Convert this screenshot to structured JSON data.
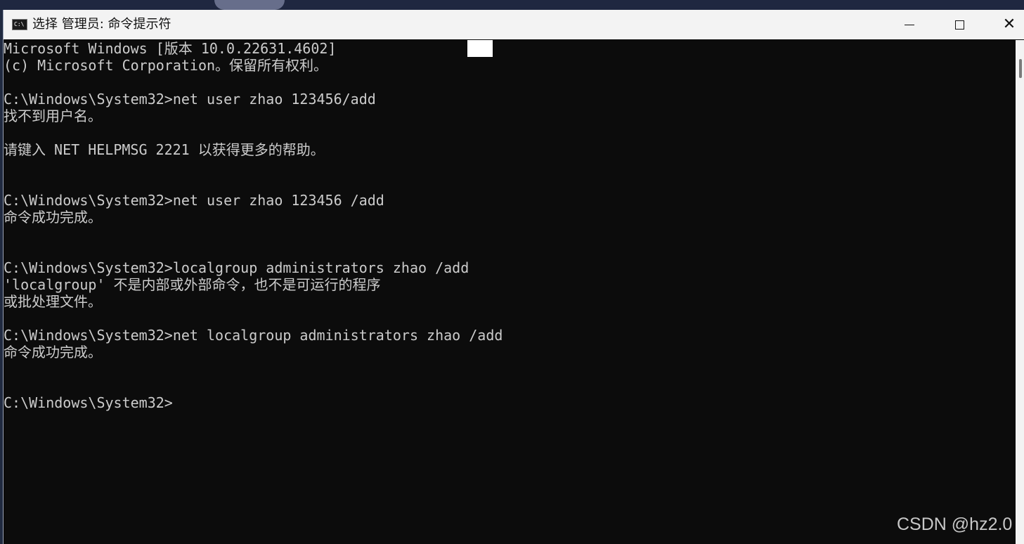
{
  "window": {
    "title": "选择 管理员: 命令提示符",
    "app_icon_text": "C:\\"
  },
  "controls": {
    "minimize": "minimize",
    "maximize": "maximize",
    "close": "close"
  },
  "terminal": {
    "lines": [
      "Microsoft Windows [版本 10.0.22631.4602]",
      "(c) Microsoft Corporation。保留所有权利。",
      "",
      "C:\\Windows\\System32>net user zhao 123456/add",
      "找不到用户名。",
      "",
      "请键入 NET HELPMSG 2221 以获得更多的帮助。",
      "",
      "",
      "C:\\Windows\\System32>net user zhao 123456 /add",
      "命令成功完成。",
      "",
      "",
      "C:\\Windows\\System32>localgroup administrators zhao /add",
      "'localgroup' 不是内部或外部命令，也不是可运行的程序",
      "或批处理文件。",
      "",
      "C:\\Windows\\System32>net localgroup administrators zhao /add",
      "命令成功完成。",
      "",
      "",
      "C:\\Windows\\System32>"
    ]
  },
  "watermark": "CSDN @hz2.0",
  "colors": {
    "terminal_bg": "#0c0c0c",
    "terminal_text": "#cccccc",
    "titlebar_bg": "#f3f3f3"
  }
}
